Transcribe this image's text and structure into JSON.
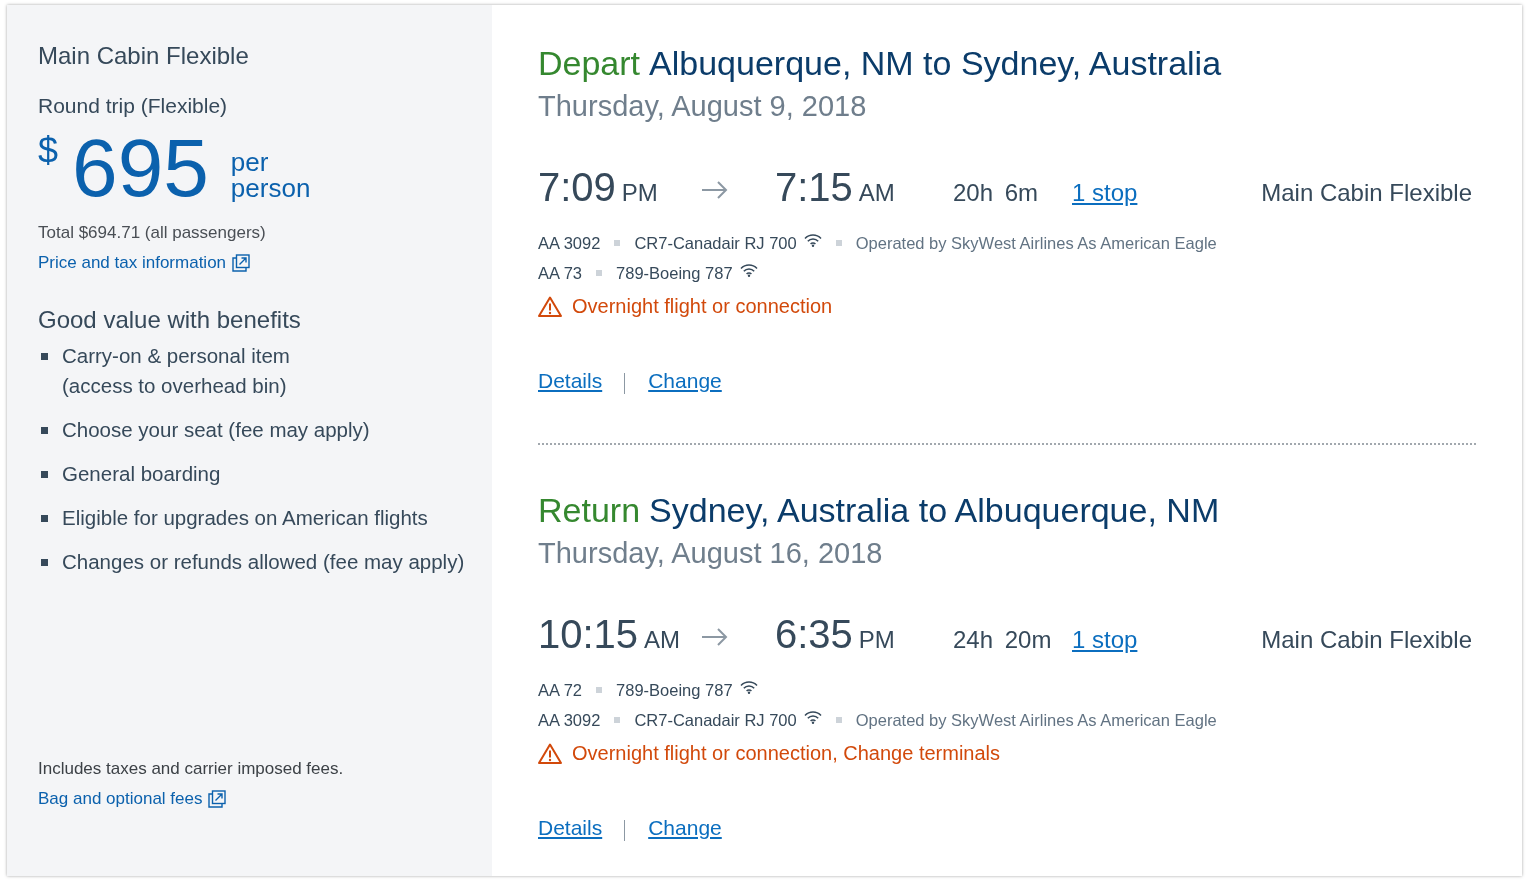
{
  "fare_summary": {
    "cabin": "Main Cabin Flexible",
    "trip_type": "Round trip (Flexible)",
    "price": {
      "currency": "$",
      "amount": "695",
      "unit": "per person"
    },
    "total": "Total $694.71 (all passengers)",
    "price_link": "Price and tax information",
    "benefits_title": "Good value with benefits",
    "benefits": [
      "Carry-on & personal item\n(access to overhead bin)",
      "Choose your seat (fee may apply)",
      "General boarding",
      "Eligible for upgrades on American flights",
      "Changes or refunds allowed (fee may apply)"
    ],
    "footnote": "Includes taxes and carrier imposed fees.",
    "fees_link": "Bag and optional fees"
  },
  "flights": [
    {
      "direction": "Depart",
      "route": "Albuquerque, NM to Sydney, Australia",
      "date": "Thursday, August 9, 2018",
      "depart_time": "7:09",
      "depart_period": "PM",
      "arrive_time": "7:15",
      "arrive_period": "AM",
      "duration": "20h 6m",
      "stops": "1 stop",
      "cabin": "Main Cabin Flexible",
      "segments": [
        {
          "flight": "AA 3092",
          "aircraft": "CR7-Canadair RJ 700",
          "wifi": true,
          "operator": "Operated by SkyWest Airlines As American Eagle"
        },
        {
          "flight": "AA 73",
          "aircraft": "789-Boeing 787",
          "wifi": true
        }
      ],
      "warning": "Overnight flight or connection",
      "links": [
        "Details",
        "Change"
      ]
    },
    {
      "direction": "Return",
      "route": "Sydney, Australia to Albuquerque, NM",
      "date": "Thursday, August 16, 2018",
      "depart_time": "10:15",
      "depart_period": "AM",
      "arrive_time": "6:35",
      "arrive_period": "PM",
      "duration": "24h 20m",
      "stops": "1 stop",
      "cabin": "Main Cabin Flexible",
      "segments": [
        {
          "flight": "AA 72",
          "aircraft": "789-Boeing 787",
          "wifi": true
        },
        {
          "flight": "AA 3092",
          "aircraft": "CR7-Canadair RJ 700",
          "wifi": true,
          "operator": "Operated by SkyWest Airlines As American Eagle"
        }
      ],
      "warning": "Overnight flight or connection, Change terminals",
      "links": [
        "Details",
        "Change"
      ]
    }
  ]
}
